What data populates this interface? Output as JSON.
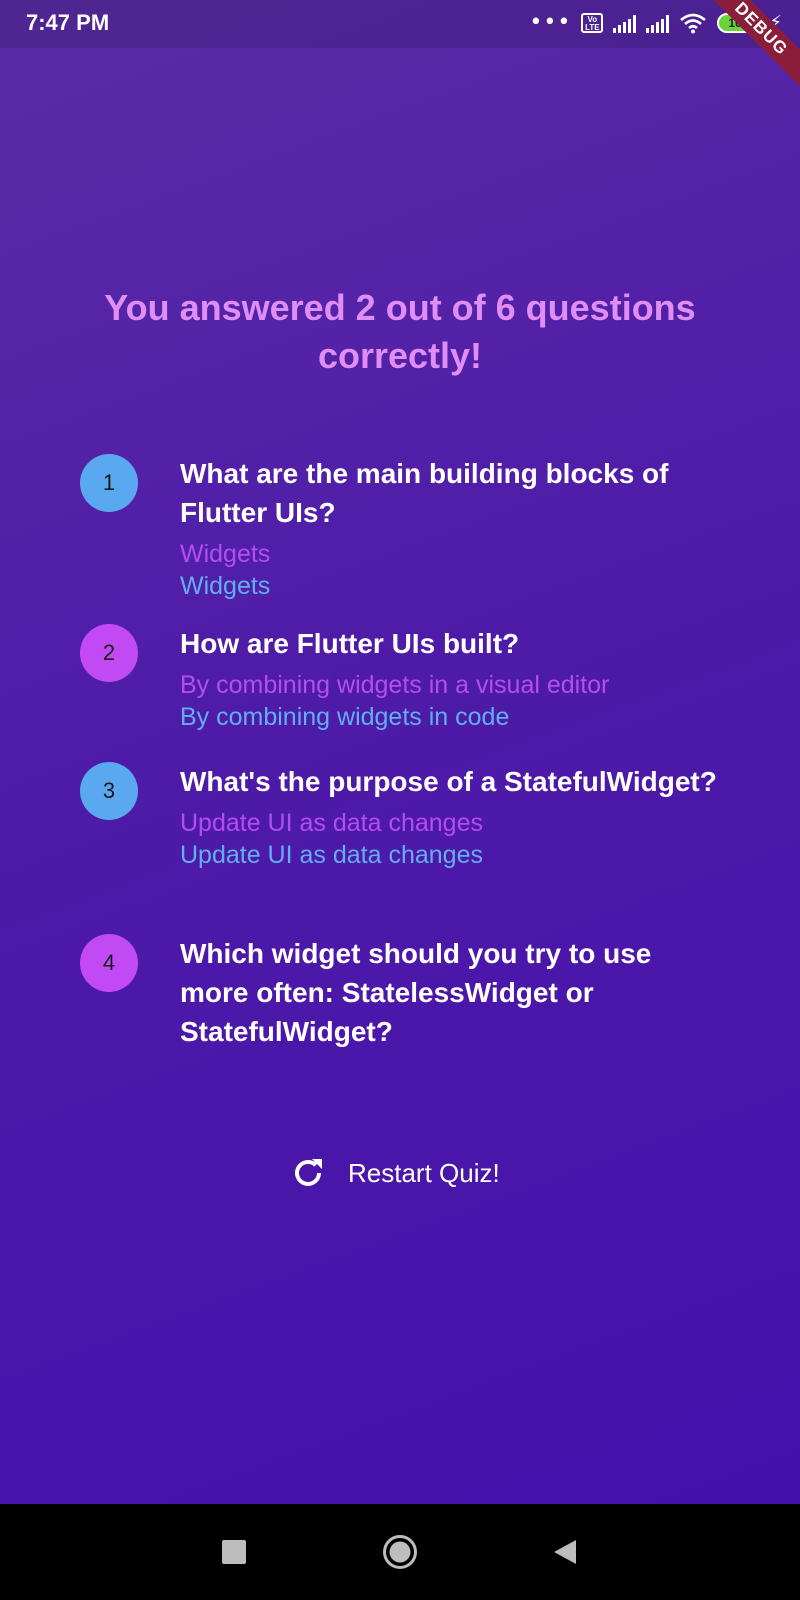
{
  "status_bar": {
    "time": "7:47 PM",
    "battery": "100",
    "volte_label": "Vo LTE",
    "debug_banner": "DEBUG"
  },
  "result": {
    "title": "You answered 2 out of 6 questions correctly!"
  },
  "summary": [
    {
      "number": "1",
      "question": "What are the main building blocks of Flutter UIs?",
      "user_answer": "Widgets",
      "correct_answer": "Widgets",
      "badge_color": "#5aa8ef"
    },
    {
      "number": "2",
      "question": "How are Flutter UIs built?",
      "user_answer": "By combining widgets in a visual editor",
      "correct_answer": "By combining widgets in code",
      "badge_color": "#c14af4"
    },
    {
      "number": "3",
      "question": "What's the purpose of a StatefulWidget?",
      "user_answer": "Update UI as data changes",
      "correct_answer": "Update UI as data changes",
      "badge_color": "#5aa8ef"
    },
    {
      "number": "4",
      "question": "Which widget should you try to use more often: StatelessWidget or StatefulWidget?",
      "user_answer": "",
      "correct_answer": "",
      "badge_color": "#c14af4"
    }
  ],
  "restart_button": {
    "label": "Restart Quiz!",
    "icon": "refresh-icon"
  },
  "nav_bar": {
    "icons": [
      "recents-icon",
      "home-icon",
      "back-icon"
    ]
  },
  "colors": {
    "background_top": "#5a2ca6",
    "background_bottom": "#4510ad",
    "title": "#e08ef6",
    "user_answer": "#b44df1",
    "correct_answer": "#63aef0"
  }
}
